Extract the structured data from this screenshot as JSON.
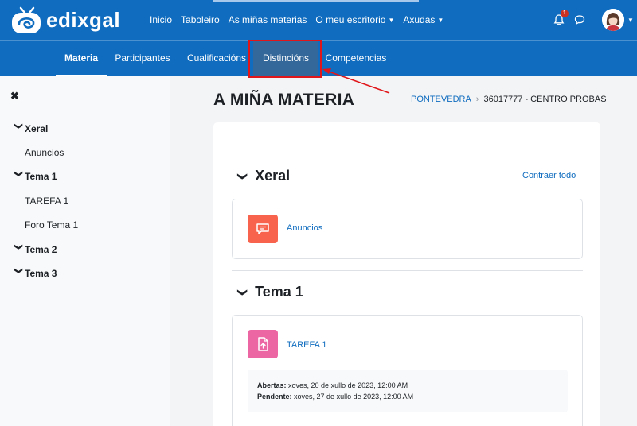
{
  "brand": {
    "name": "edixgal"
  },
  "topnav": {
    "items": [
      {
        "label": "Inicio",
        "dropdown": false
      },
      {
        "label": "Taboleiro",
        "dropdown": false
      },
      {
        "label": "As miñas materias",
        "dropdown": false
      },
      {
        "label": "O meu escritorio",
        "dropdown": true
      },
      {
        "label": "Axudas",
        "dropdown": true
      }
    ],
    "notifications_count": "1"
  },
  "secondary_nav": {
    "items": [
      {
        "label": "Materia",
        "active": true
      },
      {
        "label": "Participantes",
        "active": false
      },
      {
        "label": "Cualificacións",
        "active": false
      },
      {
        "label": "Distincións",
        "active": false,
        "highlighted": true
      },
      {
        "label": "Competencias",
        "active": false
      }
    ]
  },
  "drawer": {
    "items": [
      {
        "label": "Xeral",
        "type": "section"
      },
      {
        "label": "Anuncios",
        "type": "child"
      },
      {
        "label": "Tema 1",
        "type": "section"
      },
      {
        "label": "TAREFA 1",
        "type": "child"
      },
      {
        "label": "Foro Tema 1",
        "type": "child"
      },
      {
        "label": "Tema 2",
        "type": "section"
      },
      {
        "label": "Tema 3",
        "type": "section"
      }
    ]
  },
  "page": {
    "title": "A MIÑA MATERIA",
    "breadcrumb": [
      "PONTEVEDRA",
      "36017777 - CENTRO PROBAS"
    ]
  },
  "course": {
    "collapse_all": "Contraer todo",
    "sections": [
      {
        "title": "Xeral",
        "activities": [
          {
            "name": "Anuncios",
            "icon": "forum-icon",
            "color": "#f7634d"
          }
        ]
      },
      {
        "title": "Tema 1",
        "activities": [
          {
            "name": "TAREFA 1",
            "icon": "assignment-icon",
            "color": "#eb66a2",
            "dates": [
              {
                "label": "Abertas:",
                "value": "xoves, 20 de xullo de 2023, 12:00 AM"
              },
              {
                "label": "Pendente:",
                "value": "xoves, 27 de xullo de 2023, 12:00 AM"
              }
            ]
          }
        ]
      }
    ]
  },
  "colors": {
    "brand": "#0f6cbf",
    "highlight_box": "#e0161a",
    "link": "#0f6cbf"
  }
}
